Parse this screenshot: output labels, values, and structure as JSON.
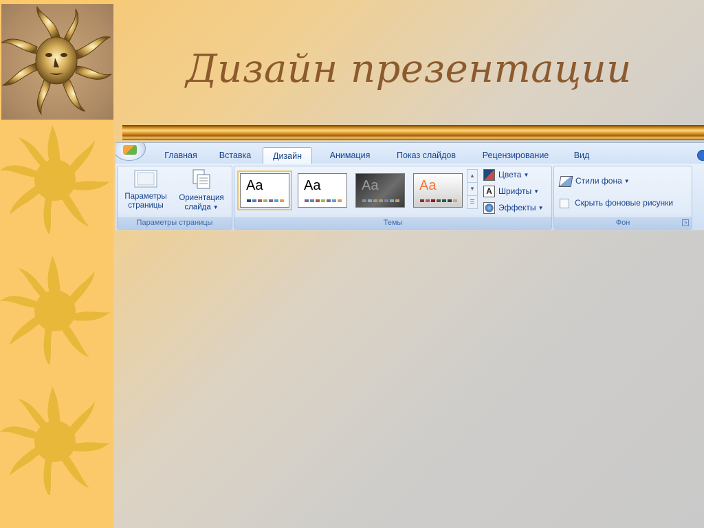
{
  "slide": {
    "title": "Дизайн презентации"
  },
  "ribbon": {
    "tabs": [
      {
        "label": "Главная"
      },
      {
        "label": "Вставка"
      },
      {
        "label": "Дизайн"
      },
      {
        "label": "Анимация"
      },
      {
        "label": "Показ слайдов"
      },
      {
        "label": "Рецензирование"
      },
      {
        "label": "Вид"
      }
    ],
    "active_tab": "Дизайн",
    "groups": {
      "page_setup": {
        "label": "Параметры страницы",
        "page_setup_btn": {
          "line1": "Параметры",
          "line2": "страницы"
        },
        "orientation_btn": {
          "line1": "Ориентация",
          "line2": "слайда"
        }
      },
      "themes": {
        "label": "Темы",
        "thumb_text": "Aa",
        "colors_btn": "Цвета",
        "fonts_btn": "Шрифты",
        "effects_btn": "Эффекты"
      },
      "background": {
        "label": "Фон",
        "styles_btn": "Стили фона",
        "hide_graphics_label": "Скрыть фоновые рисунки",
        "hide_graphics_checked": false
      }
    }
  },
  "colors": {
    "title": "#8c5a2d",
    "sun": "#e8b83a",
    "strip": "#fcc96a",
    "ribbon_text": "#15428b"
  }
}
